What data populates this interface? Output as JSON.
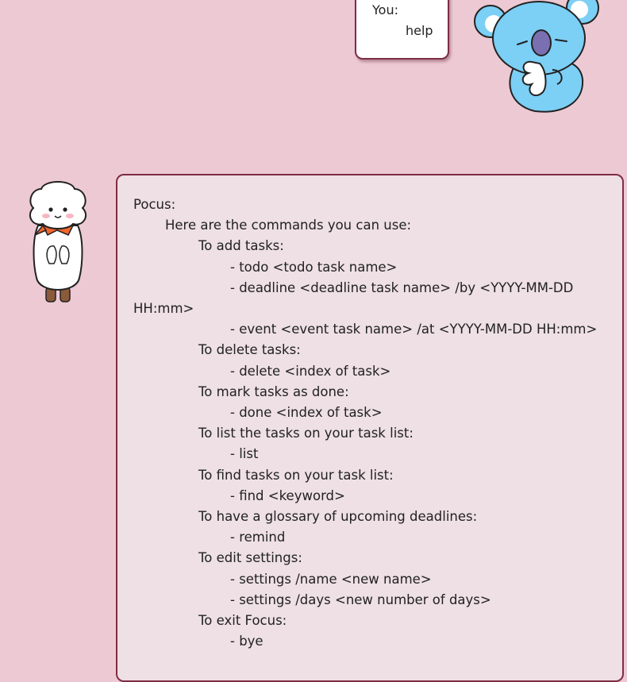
{
  "user_message": {
    "sender": "You:",
    "text": "help"
  },
  "bot_message": {
    "sender": "Pocus:",
    "intro": "Here are the commands you can use:",
    "lines": [
      {
        "level": 2,
        "text": "To add tasks:"
      },
      {
        "level": 3,
        "text": "- todo <todo task name>"
      },
      {
        "level": 3,
        "text": "- deadline <deadline task name> /by <YYYY-MM-DD"
      },
      {
        "level": 0,
        "text": "HH:mm>"
      },
      {
        "level": 3,
        "text": "- event <event task name> /at <YYYY-MM-DD HH:mm>"
      },
      {
        "level": 2,
        "text": "To delete tasks:"
      },
      {
        "level": 3,
        "text": "- delete <index of task>"
      },
      {
        "level": 2,
        "text": "To mark tasks as done:"
      },
      {
        "level": 3,
        "text": "- done <index of task>"
      },
      {
        "level": 2,
        "text": "To list the tasks on your task list:"
      },
      {
        "level": 3,
        "text": "- list"
      },
      {
        "level": 2,
        "text": "To find tasks on your task list:"
      },
      {
        "level": 3,
        "text": "- find <keyword>"
      },
      {
        "level": 2,
        "text": "To have a glossary of upcoming deadlines:"
      },
      {
        "level": 3,
        "text": "- remind"
      },
      {
        "level": 2,
        "text": "To edit settings:"
      },
      {
        "level": 3,
        "text": "- settings /name <new name>"
      },
      {
        "level": 3,
        "text": "- settings /days <new number of days>"
      },
      {
        "level": 2,
        "text": "To exit Focus:"
      },
      {
        "level": 3,
        "text": "- bye"
      }
    ]
  },
  "avatars": {
    "user": "koala-avatar",
    "bot": "sheep-avatar"
  },
  "colors": {
    "background": "#edc9d3",
    "bubble_border": "#7f2c44",
    "user_bubble": "#ffffff",
    "bot_bubble": "#eee0e5",
    "koala_blue": "#7ccff5",
    "sheep_scarf": "#f0672e"
  }
}
